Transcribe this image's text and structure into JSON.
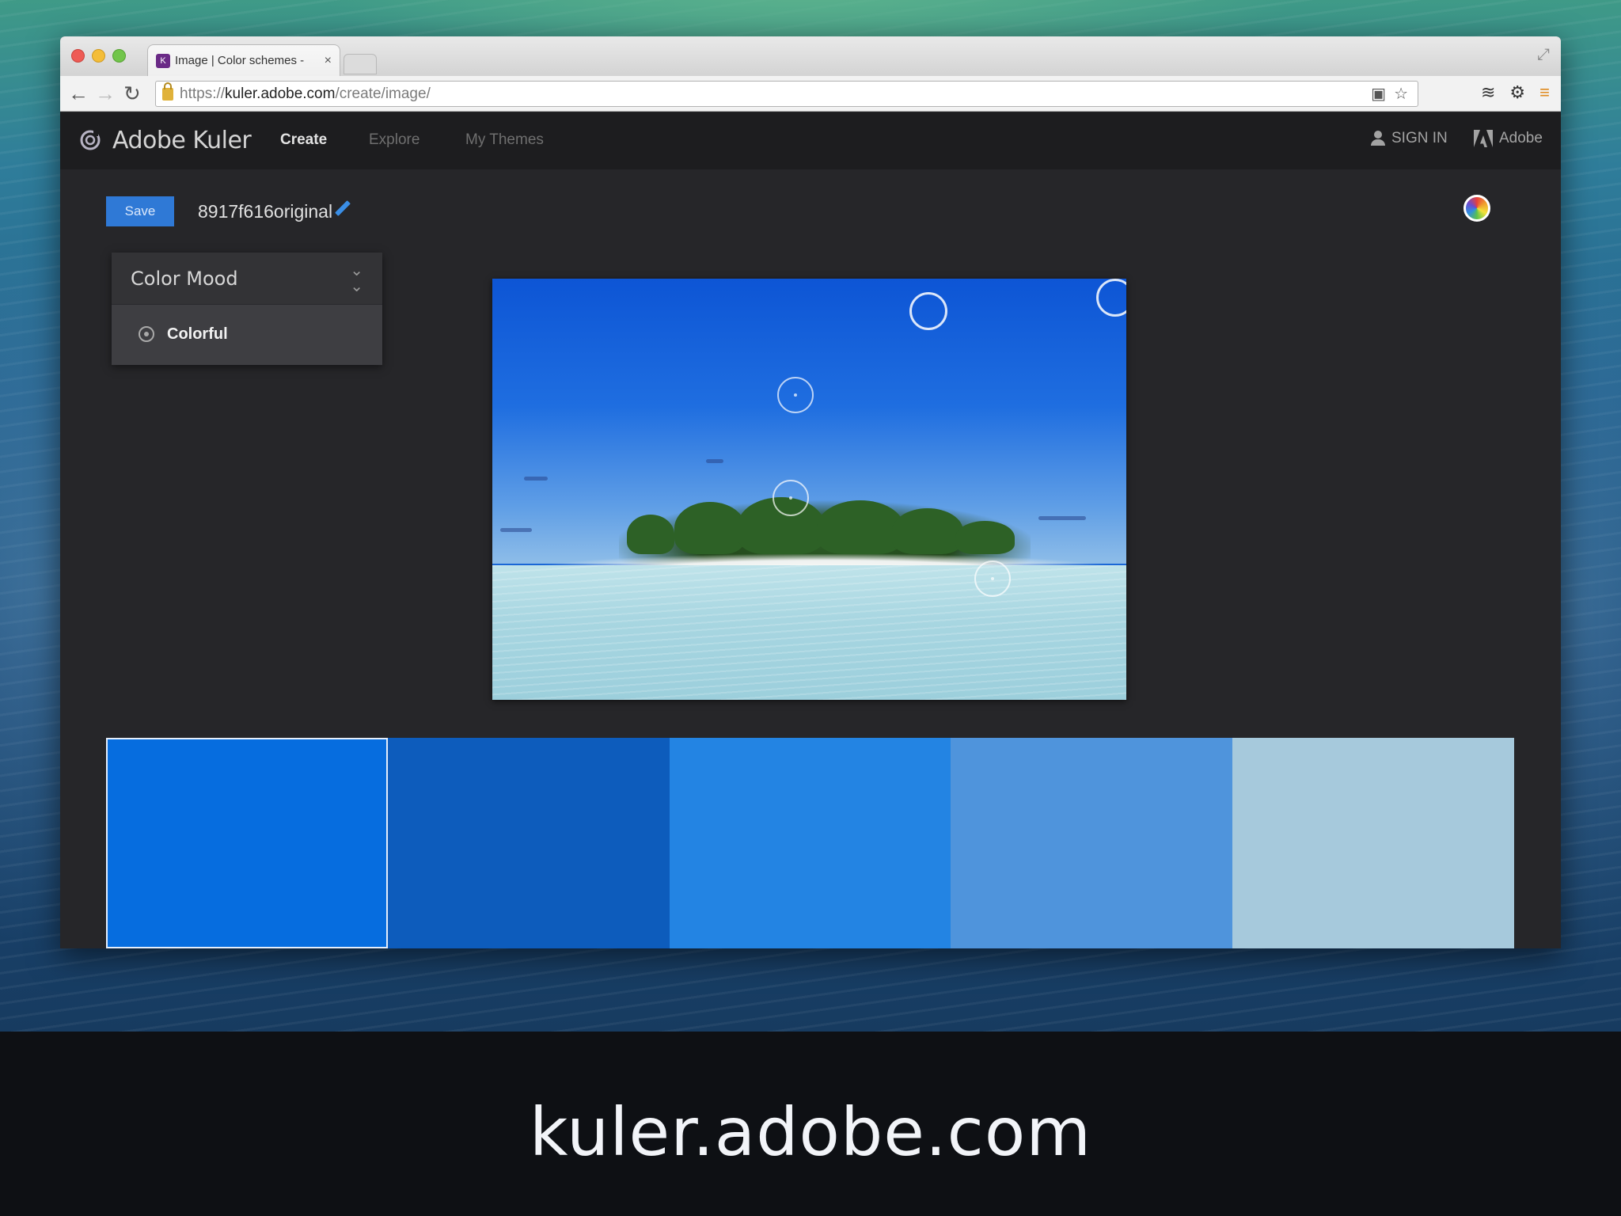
{
  "browser": {
    "tab_title": "Image | Color schemes -",
    "tab_close": "×",
    "url_scheme": "https://",
    "url_host": "kuler.adobe.com",
    "url_path": "/create/image/"
  },
  "app": {
    "brand": "Adobe Kuler",
    "nav": [
      "Create",
      "Explore",
      "My Themes"
    ],
    "active_nav": "Create",
    "sign_in": "SIGN IN",
    "adobe": "Adobe"
  },
  "editor": {
    "save_label": "Save",
    "theme_name": "8917f616original"
  },
  "mood": {
    "title": "Color Mood",
    "selected": "Colorful"
  },
  "swatches": [
    "#066ddf",
    "#0d5cbc",
    "#2384e3",
    "#4f94dc",
    "#a6c9dc"
  ],
  "selected_swatch": 0,
  "caption": "kuler.adobe.com"
}
